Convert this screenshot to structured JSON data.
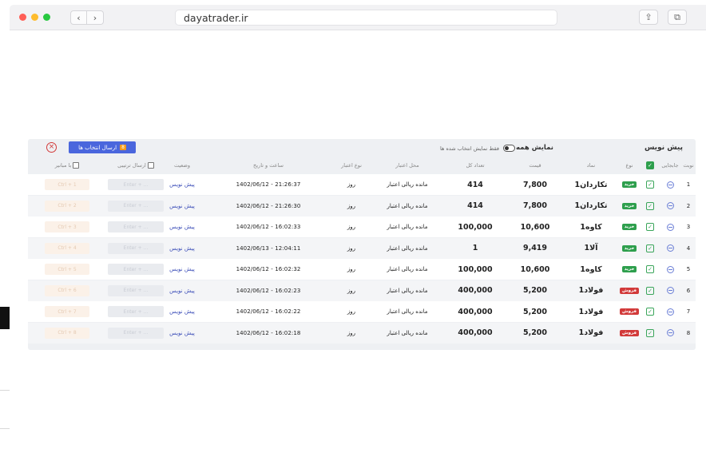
{
  "browser": {
    "url": "dayatrader.ir",
    "light_colors": [
      "#ff5f57",
      "#febc2e",
      "#28c840"
    ],
    "back_icon": "chevron-left-icon",
    "forward_icon": "chevron-right-icon",
    "back_label": "‹",
    "forward_label": "›",
    "share_icon": "share-icon",
    "tabs_icon": "tabs-icon",
    "share_label": "⇪",
    "tabs_label": "⧉"
  },
  "panel": {
    "title": "پیش نویس",
    "show_all": "نمایش همه",
    "only_selected": "فقط نمایش انتخاب شده ها",
    "send_selected": "ارسال انتخاب ها",
    "send_count": "8",
    "close_label": "×"
  },
  "columns": {
    "idx": "نوبت",
    "move": "جابجایی",
    "check": "✓",
    "type": "نوع",
    "symbol": "نماد",
    "price": "قیمت",
    "qty": "تعداد کل",
    "credit": "محل اعتبار",
    "credit_type": "نوع اعتبار",
    "time": "ساعت و تاریخ",
    "status": "وضعیت",
    "sequential": "ارسال ترتیبی",
    "with_broker": "با مبانیر"
  },
  "rows": [
    {
      "idx": "1",
      "type": "خرید",
      "side": "buy",
      "symbol": "تکاردان1",
      "price": "7,800",
      "qty": "414",
      "credit": "مانده ریالی اعتبار",
      "credit_type": "روز",
      "time": "21:26:37 - 1402/06/12",
      "status": "پیش نویس",
      "seq": "Enter + ...",
      "send": "Ctrl + 1"
    },
    {
      "idx": "2",
      "type": "خرید",
      "side": "buy",
      "symbol": "تکاردان1",
      "price": "7,800",
      "qty": "414",
      "credit": "مانده ریالی اعتبار",
      "credit_type": "روز",
      "time": "21:26:30 - 1402/06/12",
      "status": "پیش نویس",
      "seq": "Enter + ...",
      "send": "Ctrl + 2"
    },
    {
      "idx": "3",
      "type": "خرید",
      "side": "buy",
      "symbol": "کاوه1",
      "price": "10,600",
      "qty": "100,000",
      "credit": "مانده ریالی اعتبار",
      "credit_type": "روز",
      "time": "16:02:33 - 1402/06/12",
      "status": "پیش نویس",
      "seq": "Enter + ...",
      "send": "Ctrl + 3"
    },
    {
      "idx": "4",
      "type": "خرید",
      "side": "buy",
      "symbol": "آلا1",
      "price": "9,419",
      "qty": "1",
      "credit": "مانده ریالی اعتبار",
      "credit_type": "روز",
      "time": "12:04:11 - 1402/06/13",
      "status": "پیش نویس",
      "seq": "Enter + ...",
      "send": "Ctrl + 4"
    },
    {
      "idx": "5",
      "type": "خرید",
      "side": "buy",
      "symbol": "کاوه1",
      "price": "10,600",
      "qty": "100,000",
      "credit": "مانده ریالی اعتبار",
      "credit_type": "روز",
      "time": "16:02:32 - 1402/06/12",
      "status": "پیش نویس",
      "seq": "Enter + ...",
      "send": "Ctrl + 5"
    },
    {
      "idx": "6",
      "type": "فروش",
      "side": "sell",
      "symbol": "فولاد1",
      "price": "5,200",
      "qty": "400,000",
      "credit": "مانده ریالی اعتبار",
      "credit_type": "روز",
      "time": "16:02:23 - 1402/06/12",
      "status": "پیش نویس",
      "seq": "Enter + ...",
      "send": "Ctrl + 6"
    },
    {
      "idx": "7",
      "type": "فروش",
      "side": "sell",
      "symbol": "فولاد1",
      "price": "5,200",
      "qty": "400,000",
      "credit": "مانده ریالی اعتبار",
      "credit_type": "روز",
      "time": "16:02:22 - 1402/06/12",
      "status": "پیش نویس",
      "seq": "Enter + ...",
      "send": "Ctrl + 7"
    },
    {
      "idx": "8",
      "type": "فروش",
      "side": "sell",
      "symbol": "فولاد1",
      "price": "5,200",
      "qty": "400,000",
      "credit": "مانده ریالی اعتبار",
      "credit_type": "روز",
      "time": "16:02:18 - 1402/06/12",
      "status": "پیش نویس",
      "seq": "Enter + ...",
      "send": "Ctrl + 8"
    }
  ],
  "colors": {
    "accent": "#4a66dd",
    "buy": "#2e9f4d",
    "sell": "#d23a3a",
    "status": "#3b4db8"
  }
}
